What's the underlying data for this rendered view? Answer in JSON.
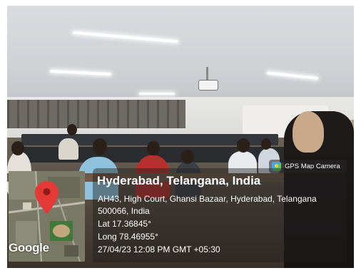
{
  "badge": {
    "app_name": "GPS Map Camera",
    "icon": "gps-map-camera-app-icon"
  },
  "location": {
    "title": "Hyderabad, Telangana, India",
    "address_line1": "AH43, High Court, Ghansi Bazaar, Hyderabad, Telangana",
    "address_line2": "500066, India",
    "lat": "Lat 17.36845°",
    "long": "Long 78.46955°",
    "timestamp": "27/04/23 12:08 PM GMT +05:30"
  },
  "map": {
    "provider_logo": "Google",
    "pin_color": "#e53935"
  },
  "colors": {
    "overlay": "#1e1e1e",
    "text": "#ffffff"
  }
}
